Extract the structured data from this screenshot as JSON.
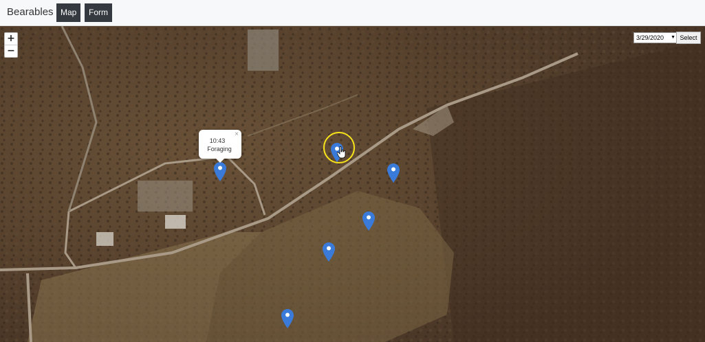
{
  "navbar": {
    "brand": "Bearables",
    "map_label": "Map",
    "form_label": "Form"
  },
  "map": {
    "zoom_in": "+",
    "zoom_out": "−",
    "date_value": "3/29/2020",
    "select_label": "Select",
    "marker_color": "#3a7ad8",
    "popup": {
      "time": "10:43",
      "activity": "Foraging",
      "close": "×"
    },
    "highlight_color": "#f5e21b",
    "marker_count": 7
  }
}
